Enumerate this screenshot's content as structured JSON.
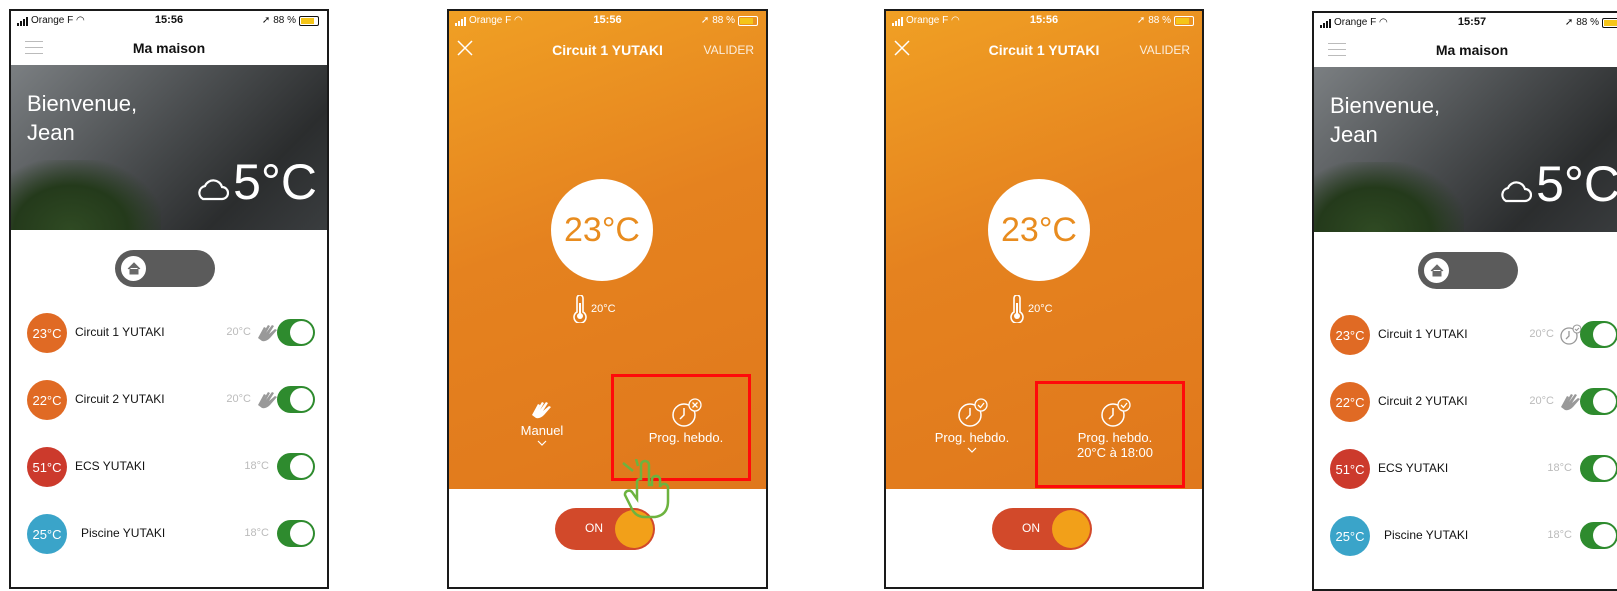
{
  "status": {
    "carrier": "Orange F",
    "battery": "88 %",
    "time_1": "15:56",
    "time_4": "15:57"
  },
  "home": {
    "title": "Ma maison",
    "welcome_line1": "Bienvenue,",
    "welcome_line2": "Jean",
    "outdoor_temp": "5°C",
    "circuits": [
      {
        "name": "Circuit 1 YUTAKI",
        "temp": "23°C",
        "setpoint": "20°C",
        "color": "#e06a24",
        "icon": "hand-icon"
      },
      {
        "name": "Circuit 2 YUTAKI",
        "temp": "22°C",
        "setpoint": "20°C",
        "color": "#e06a24",
        "icon": "hand-icon"
      },
      {
        "name": "ECS YUTAKI",
        "temp": "51°C",
        "setpoint": "18°C",
        "color": "#cc3a2c",
        "icon": ""
      },
      {
        "name": "Piscine YUTAKI",
        "temp": "25°C",
        "setpoint": "18°C",
        "color": "#3aa4c9",
        "icon": ""
      }
    ],
    "circuit1_icon_after": "clock-check-icon"
  },
  "detail": {
    "title": "Circuit 1 YUTAKI",
    "valider": "VALIDER",
    "current_temp": "23°C",
    "setpoint": "20°C",
    "mode_manual": "Manuel",
    "mode_prog": "Prog. hebdo.",
    "prog_next": "20°C à 18:00",
    "power_label": "ON"
  },
  "colors": {
    "orange": "#e5821f",
    "highlight": "#ff0a0a",
    "switch_green": "#2e8b2e",
    "tap_hand": "#6db33f"
  }
}
